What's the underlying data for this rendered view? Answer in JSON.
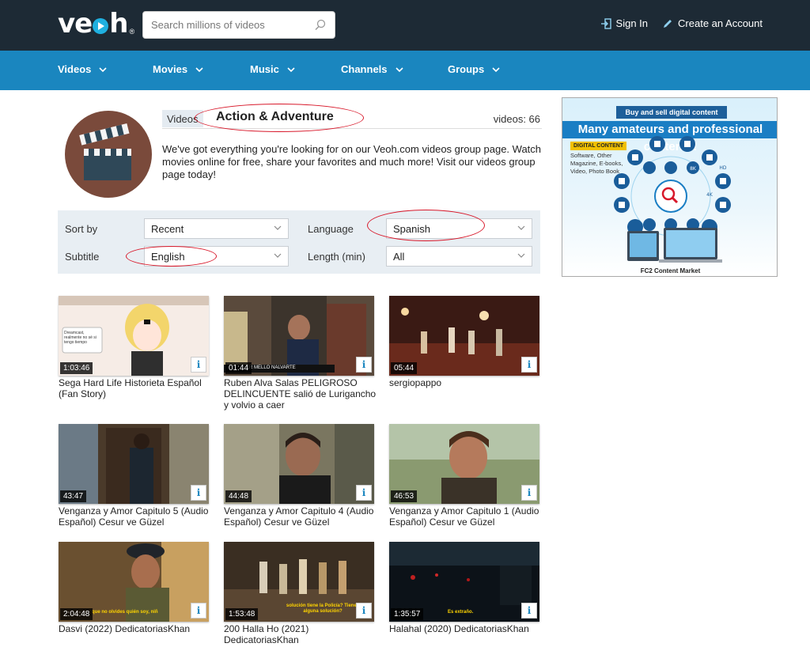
{
  "header": {
    "logo_text": "veoh",
    "logo_mark": "®",
    "search_placeholder": "Search millions of videos",
    "sign_in": "Sign In",
    "create_account": "Create an Account"
  },
  "nav": {
    "items": [
      "Videos",
      "Movies",
      "Music",
      "Channels",
      "Groups"
    ]
  },
  "group": {
    "tab_label": "Videos",
    "title": "Action & Adventure",
    "video_count": "videos: 66",
    "description": "We've got everything you're looking for on our Veoh.com videos group page. Watch movies online for free, share your favorites and much more! Visit our videos group page today!"
  },
  "filters": {
    "sort_label": "Sort by",
    "sort_value": "Recent",
    "language_label": "Language",
    "language_value": "Spanish",
    "subtitle_label": "Subtitle",
    "subtitle_value": "English",
    "length_label": "Length (min)",
    "length_value": "All"
  },
  "videos": [
    {
      "duration": "1:03:46",
      "title": "Sega Hard Life Historieta Español (Fan Story)",
      "overlay": "Dreamcast, realmente no sé si tengo tiempo"
    },
    {
      "duration": "01:44",
      "title": "Ruben Alva Salas PELIGROSO DELINCUENTE salió de Lurigancho y volvio a caer",
      "overlay": "ER MELLO NALVARTE"
    },
    {
      "duration": "05:44",
      "title": "sergiopappo",
      "overlay": ""
    },
    {
      "duration": "43:47",
      "title": "Venganza y Amor Capitulo 5 (Audio Español) Cesur ve Güzel",
      "overlay": ""
    },
    {
      "duration": "44:48",
      "title": "Venganza y Amor Capitulo 4 (Audio Español) Cesur ve Güzel",
      "overlay": ""
    },
    {
      "duration": "46:53",
      "title": "Venganza y Amor Capitulo 1 (Audio Español) Cesur ve Güzel",
      "overlay": ""
    },
    {
      "duration": "2:04:48",
      "title": "Dasvi (2022) DedicatoriasKhan",
      "overlay": "que no olvides quién soy, niñ"
    },
    {
      "duration": "1:53:48",
      "title": "200 Halla Ho (2021) DedicatoriasKhan",
      "overlay": "solución tiene la Policía? Tienes alguna solución?"
    },
    {
      "duration": "1:35:57",
      "title": "Halahal (2020) DedicatoriasKhan",
      "overlay": "Es extraño."
    }
  ],
  "info_label": "i",
  "ad": {
    "header": "Buy and sell digital content",
    "headline": "Many amateurs and professional contents!",
    "badge": "DIGITAL CONTENT",
    "detail": "Software, Other Magazine, E-books, Video, Photo Book",
    "footer": "FC2 Content Market",
    "icon_labels": [
      "8K",
      "4K",
      "HD"
    ]
  },
  "colors": {
    "topbar": "#1d2a35",
    "navbar": "#1a86bf",
    "annotation": "#d8182a"
  }
}
